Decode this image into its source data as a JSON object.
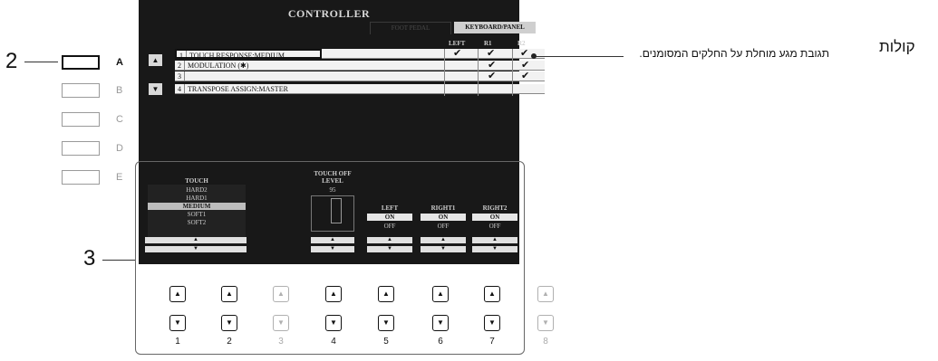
{
  "callouts": {
    "two": "2",
    "three": "3"
  },
  "side_buttons": [
    {
      "letter": "A",
      "active": true
    },
    {
      "letter": "B",
      "active": false
    },
    {
      "letter": "C",
      "active": false
    },
    {
      "letter": "D",
      "active": false
    },
    {
      "letter": "E",
      "active": false
    }
  ],
  "screen": {
    "title": "CONTROLLER",
    "tabs": [
      {
        "label": "FOOT PEDAL"
      },
      {
        "label": "KEYBOARD/PANEL"
      }
    ],
    "column_headers": [
      "LEFT",
      "R1",
      "R2"
    ],
    "rows": [
      {
        "num": "1",
        "label": "TOUCH RESPONSE:MEDIUM",
        "checks": [
          "✔",
          "✔",
          "✔"
        ]
      },
      {
        "num": "2",
        "label": "MODULATION (✱)",
        "checks": [
          "",
          "✔",
          "✔"
        ]
      },
      {
        "num": "3",
        "label": "",
        "checks": [
          "",
          "✔",
          "✔"
        ]
      },
      {
        "num": "4",
        "label": "TRANSPOSE ASSIGN:MASTER",
        "checks": [
          "",
          "",
          ""
        ]
      }
    ],
    "touch": {
      "label": "TOUCH",
      "items": [
        "HARD2",
        "HARD1",
        "MEDIUM",
        "SOFT1",
        "SOFT2"
      ],
      "selected": "MEDIUM"
    },
    "touch_off_level": {
      "label_line1": "TOUCH OFF",
      "label_line2": "LEVEL",
      "value": "95"
    },
    "parts": [
      {
        "label": "LEFT",
        "on": "ON",
        "off": "OFF"
      },
      {
        "label": "RIGHT1",
        "on": "ON",
        "off": "OFF"
      },
      {
        "label": "RIGHT2",
        "on": "ON",
        "off": "OFF"
      }
    ]
  },
  "physical_buttons": [
    {
      "num": "1",
      "enabled": true
    },
    {
      "num": "2",
      "enabled": true
    },
    {
      "num": "3",
      "enabled": false
    },
    {
      "num": "4",
      "enabled": true
    },
    {
      "num": "5",
      "enabled": true
    },
    {
      "num": "6",
      "enabled": true
    },
    {
      "num": "7",
      "enabled": true
    },
    {
      "num": "8",
      "enabled": false
    }
  ],
  "glyphs": {
    "up": "▲",
    "down": "▼"
  },
  "annotation_text": "תגובת מגע מוחלת על החלקים המסומנים.",
  "section_title": "קולות"
}
